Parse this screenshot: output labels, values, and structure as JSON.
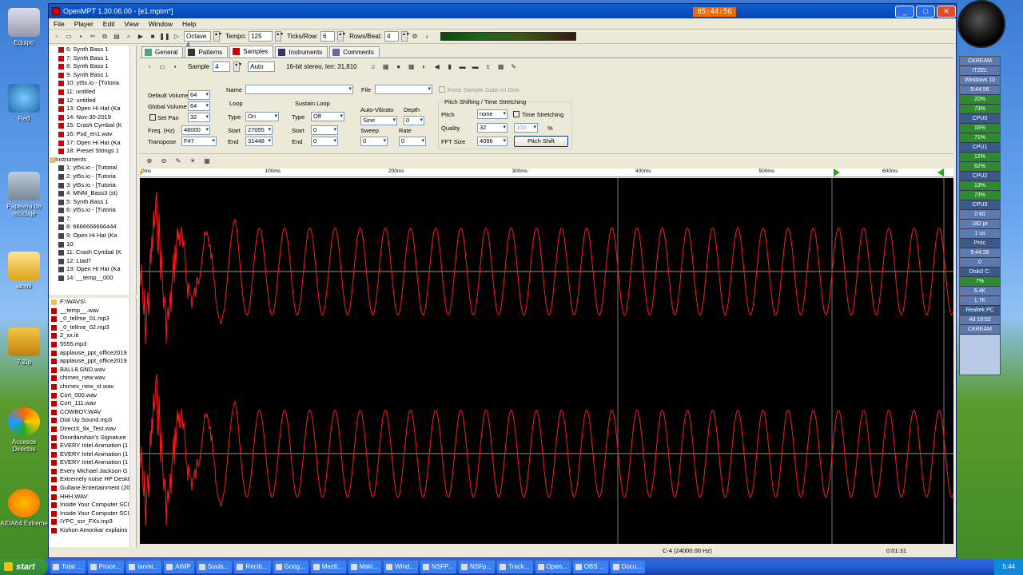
{
  "desktop_icons": [
    {
      "label": "Equipo"
    },
    {
      "label": "Red"
    },
    {
      "label": "Papelera de reciclaje"
    },
    {
      "label": "ianmi"
    },
    {
      "label": "7-Zip"
    },
    {
      "label": "Accesos Directos"
    },
    {
      "label": "AIDA64 Extreme"
    }
  ],
  "window": {
    "title": "OpenMPT 1.30.06.00 - [e1.mptm*]",
    "clock": "05:44:56"
  },
  "menu": [
    "File",
    "Player",
    "Edit",
    "View",
    "Window",
    "Help"
  ],
  "toolbar": {
    "octave": "Octave 4",
    "tempo_label": "Tempo:",
    "tempo": "125",
    "ticks_label": "Ticks/Row:",
    "ticks": "6",
    "rows_label": "Rows/Beat:",
    "rows": "4"
  },
  "tree": {
    "samples": [
      "6: Synth Bass 1",
      "7: Synth Bass 1",
      "8: Synth Bass 1",
      "9: Synth Bass 1",
      "10: yt5s.io - [Tutoria",
      "11: untitled",
      "12: untitled",
      "13: Open Hi Hat (Ka",
      "14: Nov-30-2019",
      "15: Crash Cymbal (K",
      "16: Psd_en1.wav",
      "17: Open Hi Hat (Ka",
      "18: Preset Strings 1"
    ],
    "instruments_label": "Instruments",
    "instruments": [
      "1: yt5s.io - [Tutorial",
      "2: yt5s.io - [Tutoria",
      "3: yt5s.io - [Tutoria",
      "4: MNM_Bass3 (st)",
      "5: Synth Bass 1",
      "6: yt5s.io - [Tutoria",
      "7:",
      "8: 6666666666444",
      "9: Open Hi Hat (Ka",
      "10:",
      "11: Crash Cymbal (K",
      "12: Ltad7",
      "13: Open Hi Hat (Ka",
      "14: __temp__000"
    ]
  },
  "files": [
    "F:\\WAVS\\",
    "__temp__.wav",
    "_0_tellme_01.mp3",
    "_0_tellme_02.mp3",
    "2_xx.iti",
    "5555.mp3",
    "applause_ppt_office2019",
    "applause_ppt_office2019",
    "BALL8.GND.wav",
    "chimes_new.wav",
    "chimes_new_st.wav",
    "Cort_000.wav",
    "Cort_111.wav",
    "COWBOY.WAV",
    "Dial Up Sound.mp3",
    "DirectX_9x_Test.wav",
    "Doordarshan's Signature",
    "EVERY Intel Animation (1",
    "EVERY Intel Animation (1",
    "EVERY Intel Animation (1",
    "Every Michael Jackson G",
    "Extremely noise HP Deskt",
    "Gullane Entertainment (20",
    "HHH.WAV",
    "Inside Your Computer SCI",
    "Inside Your Computer SCI",
    "IYPC_scr_FXs.mp3",
    "Kishon Amonkar explains"
  ],
  "tabs": [
    "General",
    "Patterns",
    "Samples",
    "Instruments",
    "Comments"
  ],
  "sample_bar": {
    "sample_label": "Sample",
    "sample_num": "4",
    "mode": "Auto",
    "info": "16-bit stereo, len: 31,810"
  },
  "props": {
    "default_volume_label": "Default Volume",
    "default_volume": "64",
    "global_volume_label": "Global Volume",
    "global_volume": "64",
    "set_pan_label": "Set Pan",
    "set_pan": "32",
    "freq_label": "Freq. (Hz)",
    "freq": "48000",
    "transpose_label": "Transpose",
    "transpose": "F#7",
    "name_label": "Name",
    "file_label": "File",
    "keep_label": "Keep Sample Data on Disk",
    "loop_label": "Loop",
    "loop_type_label": "Type",
    "loop_type": "On",
    "loop_start_label": "Start",
    "loop_start": "27055",
    "loop_end_label": "End",
    "loop_end": "31448",
    "sustain_label": "Sustain Loop",
    "sus_type_label": "Type",
    "sus_type": "Off",
    "sus_start_label": "Start",
    "sus_start": "0",
    "sus_end_label": "End",
    "sus_end": "0",
    "vib_label": "Auto-Vibrato",
    "vib_type": "Sine",
    "depth_label": "Depth",
    "depth": "0",
    "sweep_label": "Sweep",
    "sweep": "0",
    "rate_label": "Rate",
    "rate": "0",
    "pitch_group": "Pitch Shifting / Time Stretching",
    "pitch_label": "Pitch",
    "pitch": "none",
    "time_stretch_label": "Time Stretching",
    "quality_label": "Quality",
    "quality": "32",
    "percent": "100",
    "percent_sign": "%",
    "fft_label": "FFT Size",
    "fft": "4096",
    "pitch_shift_btn": "Pitch Shift"
  },
  "ruler": [
    "0ms",
    "100ms",
    "200ms",
    "300ms",
    "400ms",
    "500ms",
    "600ms"
  ],
  "status": {
    "note": "C-4 (24000.00 Hz)",
    "time": "0:01:31"
  },
  "wave_color": "#ff1a1a",
  "gadget": [
    "CKREAM",
    "ITZEL",
    "Windows 10",
    "5:44:56",
    "20%",
    "73%",
    "CPU0",
    "16%",
    "71%",
    "CPU1",
    "12%",
    "62%",
    "CPU2",
    "13%",
    "73%",
    "CPU3",
    "0 60",
    "182 pr",
    "1 us",
    "Proc",
    "5:44:26",
    "0",
    "Disk0 C:",
    "7%",
    "6.4K",
    "1.7K",
    "Realtek PC",
    "4d 19:52",
    "CKREAM"
  ],
  "taskbar": {
    "start": "start",
    "items": [
      "Total ...",
      "Proce...",
      "ianmi...",
      "AIMP",
      "Souls...",
      "Recib...",
      "Goog...",
      "Meztl...",
      "Maki...",
      "Wind...",
      "NSFP...",
      "NSFp...",
      "Track...",
      "Open...",
      "OBS ...",
      "Docu..."
    ],
    "time": "5:44"
  }
}
